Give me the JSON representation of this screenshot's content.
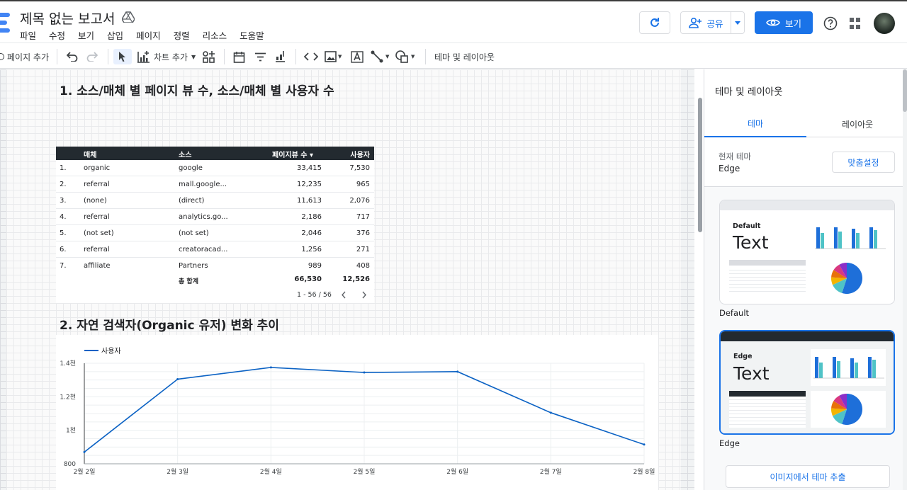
{
  "header": {
    "title": "제목 없는 보고서",
    "menu": [
      "파일",
      "수정",
      "보기",
      "삽입",
      "페이지",
      "정렬",
      "리소스",
      "도움말"
    ],
    "share_label": "공유",
    "view_label": "보기",
    "accent_color": "#1a73e8"
  },
  "toolbar": {
    "add_page": "페이지 추가",
    "add_chart": "차트 추가",
    "theme_layout": "테마 및 레이아웃"
  },
  "section1": {
    "title": "1. 소스/매체 별 페이지 뷰 수, 소스/매체 별 사용자 수"
  },
  "section2": {
    "title": "2. 자연 검색자(Organic 유저) 변화 추이"
  },
  "table": {
    "headers": [
      "매체",
      "소스",
      "페이지뷰 수",
      "사용자"
    ],
    "sort_indicator": "▾",
    "rows": [
      {
        "n": "1.",
        "medium": "organic",
        "source": "google",
        "pv": "33,415",
        "users": "7,530"
      },
      {
        "n": "2.",
        "medium": "referral",
        "source": "mall.google...",
        "pv": "12,235",
        "users": "965"
      },
      {
        "n": "3.",
        "medium": "(none)",
        "source": "(direct)",
        "pv": "11,613",
        "users": "2,076"
      },
      {
        "n": "4.",
        "medium": "referral",
        "source": "analytics.go...",
        "pv": "2,186",
        "users": "717"
      },
      {
        "n": "5.",
        "medium": "(not set)",
        "source": "(not set)",
        "pv": "2,046",
        "users": "376"
      },
      {
        "n": "6.",
        "medium": "referral",
        "source": "creatoracad...",
        "pv": "1,256",
        "users": "271"
      },
      {
        "n": "7.",
        "medium": "affiliate",
        "source": "Partners",
        "pv": "989",
        "users": "408"
      }
    ],
    "total_label": "총 합계",
    "total_pv": "66,530",
    "total_users": "12,526",
    "pagination": "1 - 56 / 56"
  },
  "chart_data": {
    "type": "line",
    "title": "",
    "x": [
      "2월 2일",
      "2월 3일",
      "2월 4일",
      "2월 5일",
      "2월 6일",
      "2월 7일",
      "2월 8일"
    ],
    "series": [
      {
        "name": "사용자",
        "values": [
          870,
          1305,
          1375,
          1345,
          1350,
          1105,
          915
        ],
        "color": "#0b62c4"
      }
    ],
    "ylim": [
      800,
      1400
    ],
    "yticks": [
      800,
      1000,
      1200,
      1400
    ],
    "ytick_labels": [
      "800",
      "1천",
      "1.2천",
      "1.4천"
    ],
    "grid": true,
    "legend": "top-left"
  },
  "panel": {
    "title": "테마 및 레이아웃",
    "tabs": [
      "테마",
      "레이아웃"
    ],
    "current_theme_label": "현재 테마",
    "current_theme_value": "Edge",
    "customize_label": "맞춤설정",
    "themes": [
      {
        "title": "Default",
        "sample_text": "Text",
        "name": "Default"
      },
      {
        "title": "Edge",
        "sample_text": "Text",
        "name": "Edge"
      }
    ],
    "extract_label": "이미지에서 테마 추출"
  }
}
